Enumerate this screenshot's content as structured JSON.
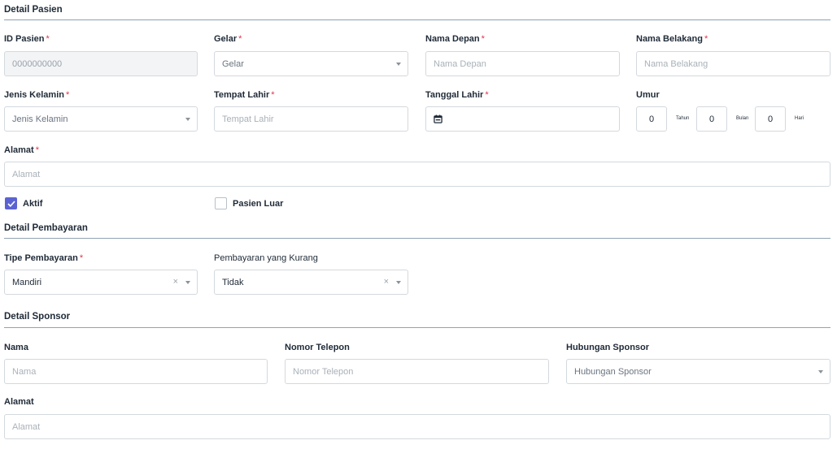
{
  "patient": {
    "title": "Detail Pasien",
    "id": {
      "label": "ID Pasien",
      "value": "0000000000"
    },
    "gelar": {
      "label": "Gelar",
      "value": "Gelar"
    },
    "nama_depan": {
      "label": "Nama Depan",
      "placeholder": "Nama Depan"
    },
    "nama_belakang": {
      "label": "Nama Belakang",
      "placeholder": "Nama Belakang"
    },
    "jenis_kelamin": {
      "label": "Jenis Kelamin",
      "value": "Jenis Kelamin"
    },
    "tempat_lahir": {
      "label": "Tempat Lahir",
      "placeholder": "Tempat Lahir"
    },
    "tanggal_lahir": {
      "label": "Tanggal Lahir"
    },
    "umur": {
      "label": "Umur",
      "tahun": "0",
      "tahun_unit": "Tahun",
      "bulan": "0",
      "bulan_unit": "Bulan",
      "hari": "0",
      "hari_unit": "Hari"
    },
    "alamat": {
      "label": "Alamat",
      "placeholder": "Alamat"
    },
    "aktif": {
      "label": "Aktif",
      "checked": true
    },
    "pasien_luar": {
      "label": "Pasien Luar",
      "checked": false
    }
  },
  "payment": {
    "title": "Detail Pembayaran",
    "tipe": {
      "label": "Tipe Pembayaran",
      "value": "Mandiri"
    },
    "kurang": {
      "label": "Pembayaran yang Kurang",
      "value": "Tidak"
    }
  },
  "sponsor": {
    "title": "Detail Sponsor",
    "nama": {
      "label": "Nama",
      "placeholder": "Nama"
    },
    "telepon": {
      "label": "Nomor Telepon",
      "placeholder": "Nomor Telepon"
    },
    "hubungan": {
      "label": "Hubungan Sponsor",
      "value": "Hubungan Sponsor"
    },
    "alamat": {
      "label": "Alamat",
      "placeholder": "Alamat"
    }
  },
  "icons": {
    "calendar": "calendar-icon",
    "caret": "chevron-down-icon",
    "clear": "close-icon",
    "check": "check-icon"
  },
  "colors": {
    "accent": "#5b63d3",
    "required": "#e0344b",
    "border": "#d3d9de"
  }
}
